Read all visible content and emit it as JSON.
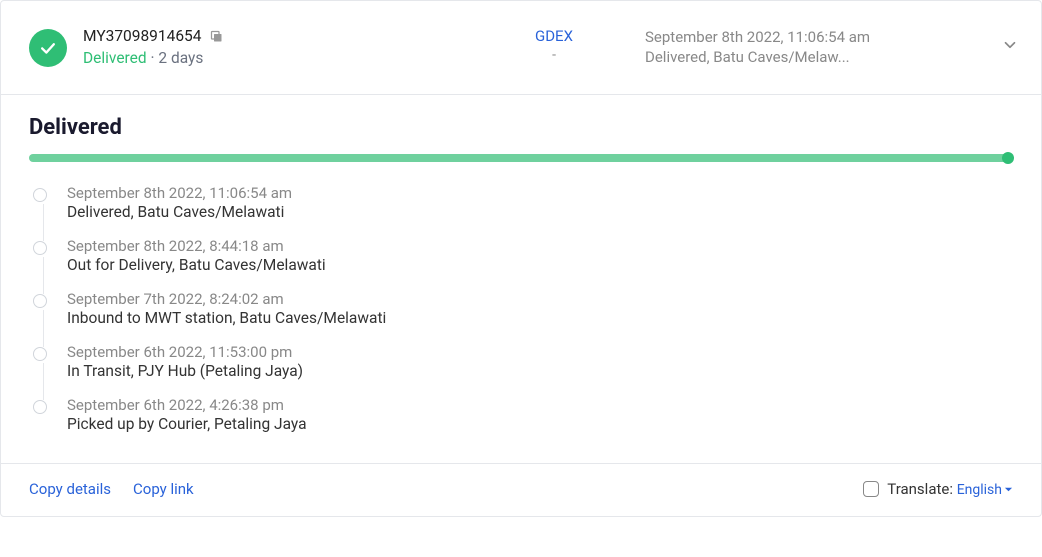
{
  "header": {
    "tracking_number": "MY37098914654",
    "status_label": "Delivered",
    "duration": "2 days",
    "carrier": "GDEX",
    "carrier_sub": "-",
    "latest_time": "September 8th 2022, 11:06:54 am",
    "latest_status": "Delivered, Batu Caves/Melaw..."
  },
  "section_title": "Delivered",
  "timeline": [
    {
      "date": "September 8th 2022, 11:06:54 am",
      "text": "Delivered, Batu Caves/Melawati"
    },
    {
      "date": "September 8th 2022, 8:44:18 am",
      "text": "Out for Delivery, Batu Caves/Melawati"
    },
    {
      "date": "September 7th 2022, 8:24:02 am",
      "text": "Inbound to MWT station, Batu Caves/Melawati"
    },
    {
      "date": "September 6th 2022, 11:53:00 pm",
      "text": "In Transit, PJY Hub (Petaling Jaya)"
    },
    {
      "date": "September 6th 2022, 4:26:38 pm",
      "text": "Picked up by Courier, Petaling Jaya"
    }
  ],
  "footer": {
    "copy_details": "Copy details",
    "copy_link": "Copy link",
    "translate_label": "Translate: ",
    "translate_lang": "English"
  }
}
